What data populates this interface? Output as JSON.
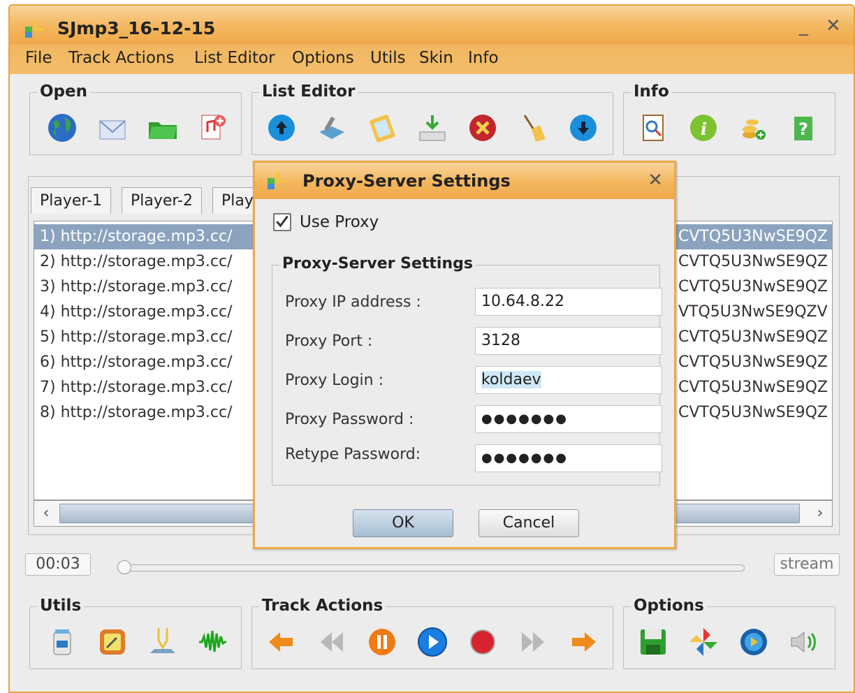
{
  "window": {
    "title": "SJmp3_16-12-15",
    "min_label": "_",
    "close_label": "✕"
  },
  "menu": [
    "File",
    "Track Actions",
    "List Editor",
    "Options",
    "Utils",
    "Skin",
    "Info"
  ],
  "groups": {
    "open": "Open",
    "list_editor": "List Editor",
    "info": "Info",
    "utils": "Utils",
    "track_actions": "Track Actions",
    "options": "Options"
  },
  "tabs": [
    "Player-1",
    "Player-2",
    "Play"
  ],
  "tracks": [
    {
      "left": "1) http://storage.mp3.cc/",
      "right": "CVTQ5U3NwSE9QZ"
    },
    {
      "left": "2) http://storage.mp3.cc/",
      "right": "CVTQ5U3NwSE9QZ"
    },
    {
      "left": "3) http://storage.mp3.cc/",
      "right": "CVTQ5U3NwSE9QZ"
    },
    {
      "left": "4) http://storage.mp3.cc/",
      "right": "VTQ5U3NwSE9QZV"
    },
    {
      "left": "5) http://storage.mp3.cc/",
      "right": "CVTQ5U3NwSE9QZ"
    },
    {
      "left": "6) http://storage.mp3.cc/",
      "right": "CVTQ5U3NwSE9QZ"
    },
    {
      "left": "7) http://storage.mp3.cc/",
      "right": "CVTQ5U3NwSE9QZ"
    },
    {
      "left": "8) http://storage.mp3.cc/",
      "right": "CVTQ5U3NwSE9QZ"
    }
  ],
  "player": {
    "time": "00:03",
    "stream": "stream",
    "position_fraction": 0.0
  },
  "dialog": {
    "title": "Proxy-Server Settings",
    "close_label": "✕",
    "use_proxy_label": "Use Proxy",
    "use_proxy_checked": true,
    "fieldset_title": "Proxy-Server Settings",
    "fields": [
      {
        "label": "Proxy IP address :",
        "value": "10.64.8.22"
      },
      {
        "label": "Proxy Port :",
        "value": "3128"
      },
      {
        "label": "Proxy Login :",
        "value": "koldaev"
      },
      {
        "label": "Proxy Password :",
        "value": "●●●●●●●"
      },
      {
        "label": "Retype Password:",
        "value": "●●●●●●●"
      }
    ],
    "ok_label": "OK",
    "cancel_label": "Cancel"
  },
  "colors": {
    "accent": "#f0a94b",
    "selection": "#8ba3be"
  }
}
